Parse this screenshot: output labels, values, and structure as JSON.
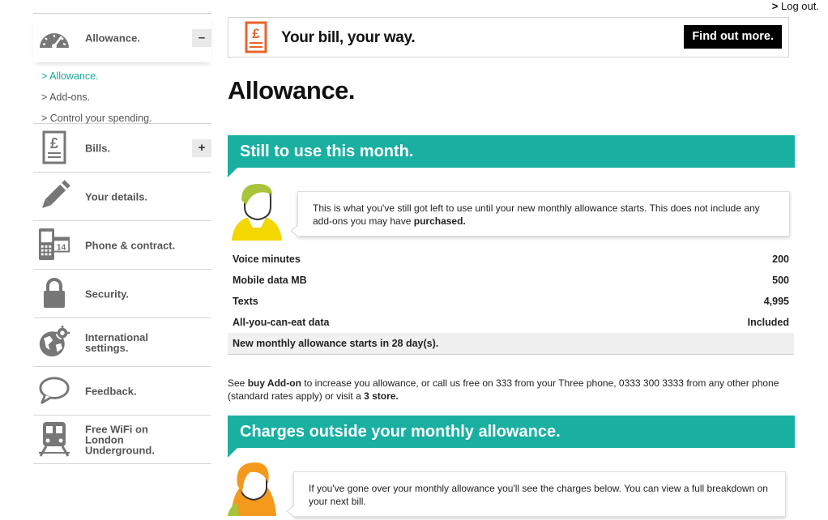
{
  "header": {
    "logout_prefix": ">",
    "logout_label": "Log out."
  },
  "sidebar": {
    "items": [
      {
        "label": "Allowance.",
        "icon": "speedometer-icon",
        "toggle": "–"
      },
      {
        "label": "Bills.",
        "icon": "bill-icon",
        "toggle": "+"
      },
      {
        "label": "Your details.",
        "icon": "pencil-icon"
      },
      {
        "label": "Phone & contract.",
        "icon": "phone-calendar-icon"
      },
      {
        "label": "Security.",
        "icon": "padlock-icon"
      },
      {
        "label": "International settings.",
        "icon": "globe-gear-icon"
      },
      {
        "label": "Feedback.",
        "icon": "speech-bubble-icon"
      },
      {
        "label": "Free WiFi on London Underground.",
        "icon": "train-icon"
      }
    ],
    "allowance_sub": [
      {
        "label": "> Allowance."
      },
      {
        "label": "> Add-ons."
      },
      {
        "label": "> Control your spending."
      }
    ],
    "calendar_day": "14"
  },
  "banner": {
    "text": "Your bill, your way.",
    "button": "Find out more.",
    "icon": "pound-bill-icon"
  },
  "main": {
    "title": "Allowance.",
    "section1": {
      "heading": "Still to use this month.",
      "bubble_text": "This is what you've still got left to use until your new monthly allowance starts. This does not include any add-ons you may have ",
      "bubble_bold": "purchased."
    },
    "table": {
      "rows": [
        {
          "label": "Voice minutes",
          "value": "200"
        },
        {
          "label": "Mobile data MB",
          "value": "500"
        },
        {
          "label": "Texts",
          "value": "4,995"
        },
        {
          "label": "All-you-can-eat data",
          "value": "Included"
        }
      ],
      "footer": "New monthly allowance starts in 28 day(s)."
    },
    "note": {
      "p1": "See ",
      "link1": "buy Add-on",
      "p2": " to increase you allowance, or call us free on 333 from your Three phone, 0333 300 3333 from any other phone (standard rates apply) or visit a ",
      "link2": "3 store."
    },
    "section2": {
      "heading": "Charges outside your monthly allowance.",
      "bubble_text": "If you've gone over your monthly allowance you'll see the charges below. You can view a full breakdown on your next bill."
    }
  },
  "colors": {
    "teal": "#19b0a2",
    "active_link": "#1aa99a",
    "avatar_yellow": "#f2d700",
    "avatar_orange": "#f39a1d",
    "avatar_green": "#a8c43a",
    "banner_icon_orange": "#e8632b"
  }
}
